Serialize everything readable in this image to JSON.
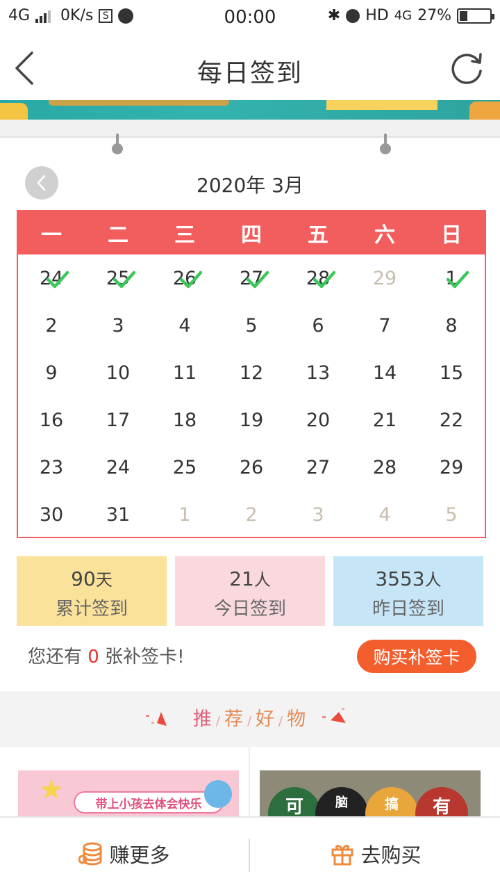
{
  "statusbar": {
    "network": "4G",
    "speed": "0K/s",
    "box_icon_text": "S",
    "time": "00:00",
    "hd_label": "HD",
    "network_right": "4G",
    "battery": "27%",
    "battery_level": 0.27
  },
  "nav": {
    "title": "每日签到"
  },
  "calendar": {
    "month_title": "2020年 3月",
    "weekdays": [
      "一",
      "二",
      "三",
      "四",
      "五",
      "六",
      "日"
    ],
    "weeks": [
      [
        {
          "d": "24",
          "other": false,
          "signed": true
        },
        {
          "d": "25",
          "other": false,
          "signed": true
        },
        {
          "d": "26",
          "other": false,
          "signed": true
        },
        {
          "d": "27",
          "other": false,
          "signed": true
        },
        {
          "d": "28",
          "other": false,
          "signed": true
        },
        {
          "d": "29",
          "other": true,
          "signed": false
        },
        {
          "d": "1",
          "other": false,
          "signed": true
        }
      ],
      [
        {
          "d": "2"
        },
        {
          "d": "3"
        },
        {
          "d": "4"
        },
        {
          "d": "5"
        },
        {
          "d": "6"
        },
        {
          "d": "7"
        },
        {
          "d": "8"
        }
      ],
      [
        {
          "d": "9"
        },
        {
          "d": "10"
        },
        {
          "d": "11"
        },
        {
          "d": "12"
        },
        {
          "d": "13"
        },
        {
          "d": "14"
        },
        {
          "d": "15"
        }
      ],
      [
        {
          "d": "16"
        },
        {
          "d": "17"
        },
        {
          "d": "18"
        },
        {
          "d": "19"
        },
        {
          "d": "20"
        },
        {
          "d": "21"
        },
        {
          "d": "22"
        }
      ],
      [
        {
          "d": "23"
        },
        {
          "d": "24"
        },
        {
          "d": "25"
        },
        {
          "d": "26"
        },
        {
          "d": "27"
        },
        {
          "d": "28"
        },
        {
          "d": "29"
        }
      ],
      [
        {
          "d": "30"
        },
        {
          "d": "31"
        },
        {
          "d": "1",
          "other": true
        },
        {
          "d": "2",
          "other": true
        },
        {
          "d": "3",
          "other": true
        },
        {
          "d": "4",
          "other": true
        },
        {
          "d": "5",
          "other": true
        }
      ]
    ]
  },
  "stats": {
    "total": {
      "num": "90",
      "unit": "天",
      "label": "累计签到"
    },
    "today": {
      "num": "21",
      "unit": "人",
      "label": "今日签到"
    },
    "yesterday": {
      "num": "3553",
      "unit": "人",
      "label": "昨日签到"
    }
  },
  "makeup": {
    "prefix": "您还有",
    "count": "0",
    "suffix": "张补签卡!",
    "buy_label": "购买补签卡"
  },
  "recommend": {
    "chars": [
      "推",
      "荐",
      "好",
      "物"
    ],
    "separator": "/"
  },
  "products": {
    "left_banner_text": "带上小孩去体会快乐",
    "right_balls": [
      "可",
      "脑",
      "搞",
      "有"
    ]
  },
  "bottom": {
    "earn_label": "赚更多",
    "shop_label": "去购买"
  },
  "colors": {
    "accent_red": "#f25d5d",
    "check_green": "#3cc75a",
    "buy_orange": "#f45d2c"
  }
}
